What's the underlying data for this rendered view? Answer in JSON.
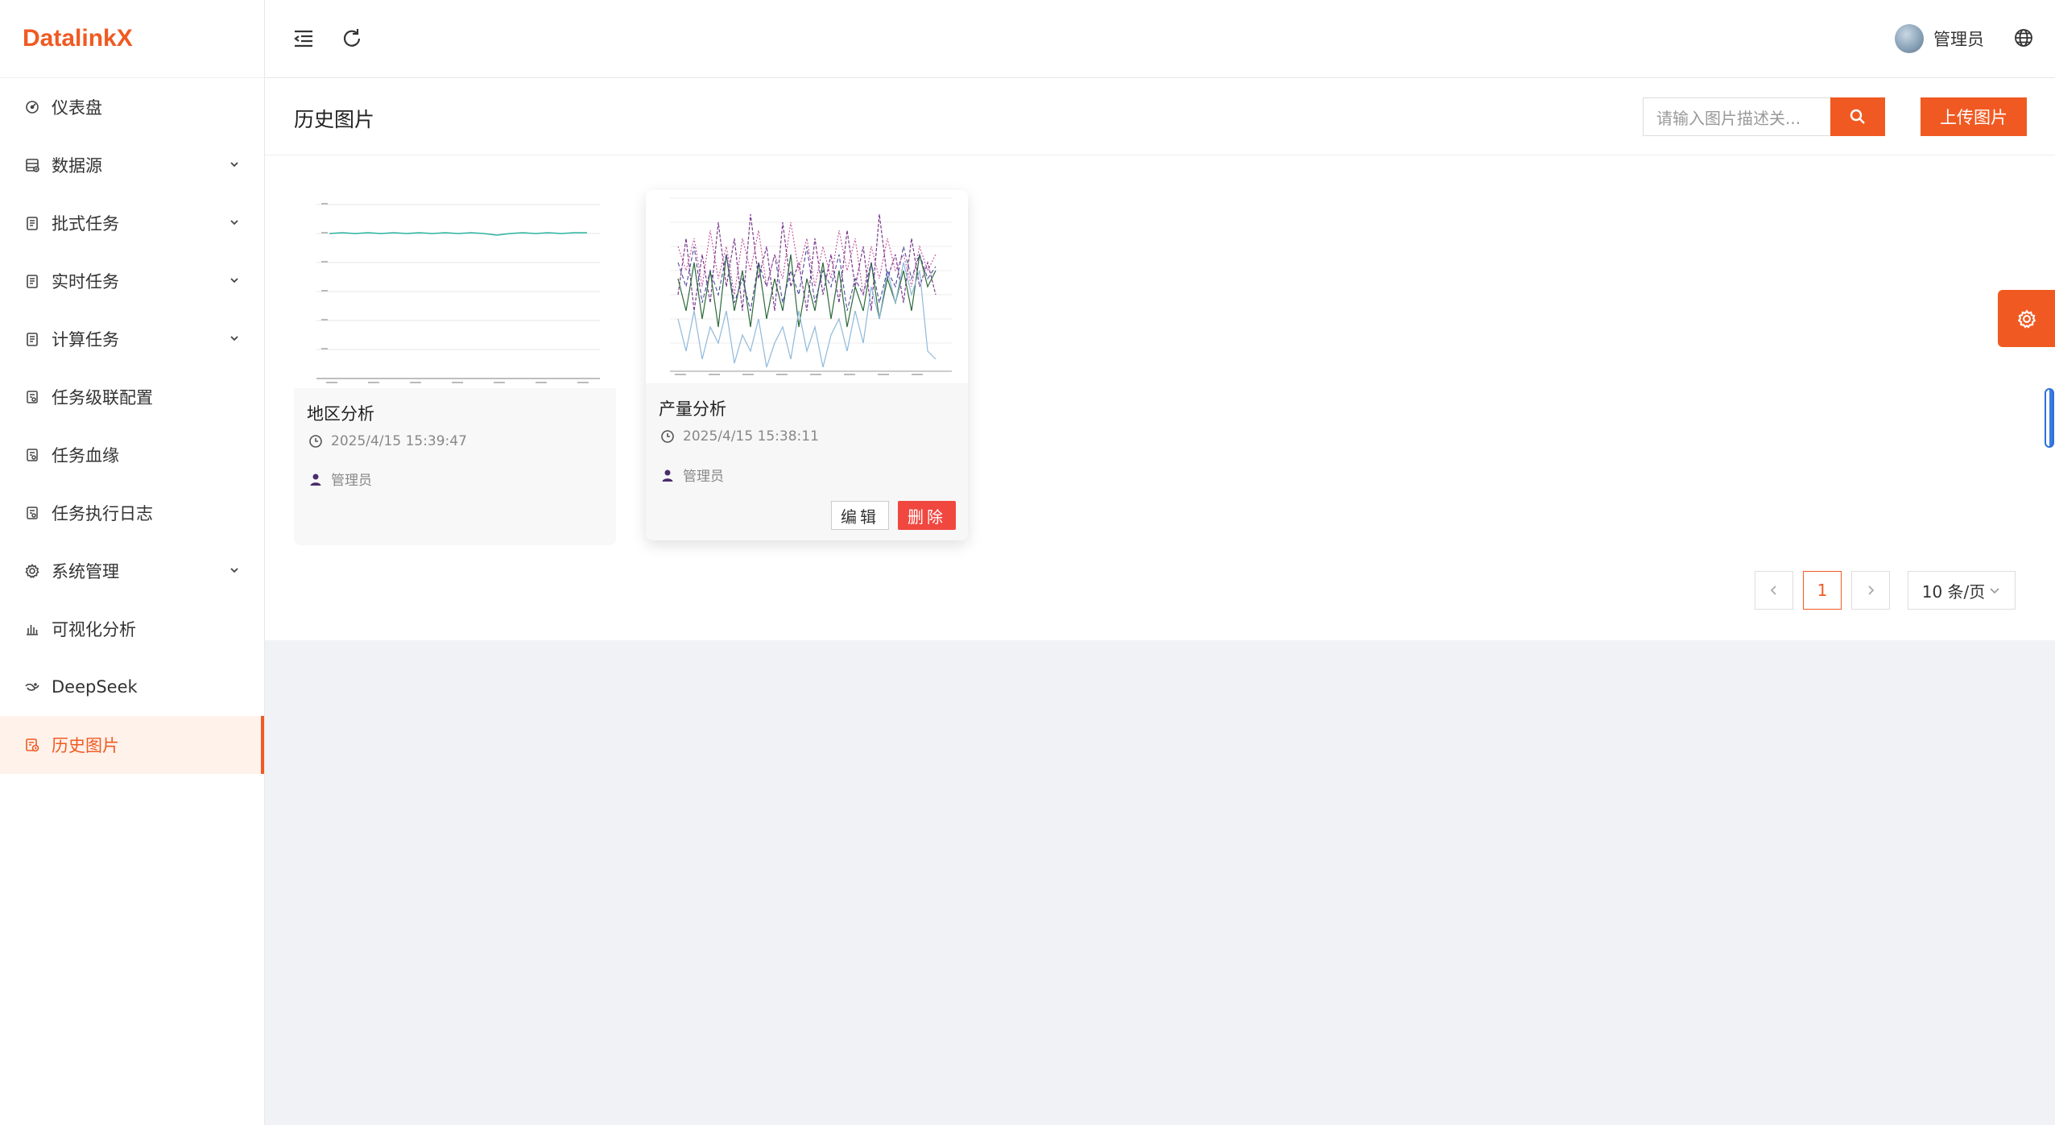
{
  "app": {
    "brand": "DatalinkX"
  },
  "sidebar": {
    "items": [
      {
        "label": "仪表盘",
        "icon": "dashboard-icon",
        "has_children": false
      },
      {
        "label": "数据源",
        "icon": "datasource-icon",
        "has_children": true
      },
      {
        "label": "批式任务",
        "icon": "clipboard-icon",
        "has_children": true
      },
      {
        "label": "实时任务",
        "icon": "clipboard-icon",
        "has_children": true
      },
      {
        "label": "计算任务",
        "icon": "clipboard-icon",
        "has_children": true
      },
      {
        "label": "任务级联配置",
        "icon": "document-icon",
        "has_children": false
      },
      {
        "label": "任务血缘",
        "icon": "document-icon",
        "has_children": false
      },
      {
        "label": "任务执行日志",
        "icon": "document-icon",
        "has_children": false
      },
      {
        "label": "系统管理",
        "icon": "gear-icon",
        "has_children": true
      },
      {
        "label": "可视化分析",
        "icon": "bar-chart-icon",
        "has_children": false
      },
      {
        "label": "DeepSeek",
        "icon": "deepseek-icon",
        "has_children": false
      },
      {
        "label": "历史图片",
        "icon": "picture-history-icon",
        "has_children": false,
        "active": true
      }
    ]
  },
  "header": {
    "user_name": "管理员"
  },
  "main": {
    "title": "历史图片",
    "search": {
      "placeholder": "请输入图片描述关..."
    },
    "upload_label": "上传图片",
    "cards": [
      {
        "title": "地区分析",
        "time": "2025/4/15 15:39:47",
        "owner": "管理员"
      },
      {
        "title": "产量分析",
        "time": "2025/4/15 15:38:11",
        "owner": "管理员",
        "edit_label": "编辑",
        "delete_label": "删除"
      }
    ],
    "pagination": {
      "current_page": "1",
      "page_size": "10 条/页"
    }
  },
  "colors": {
    "accent": "#f05a22",
    "danger": "#f0473f"
  }
}
